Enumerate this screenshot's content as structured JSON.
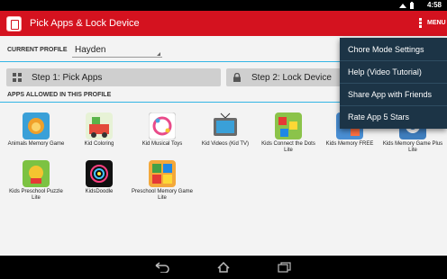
{
  "status": {
    "time": "4:58"
  },
  "appbar": {
    "title": "Pick Apps & Lock Device",
    "menu_label": "MENU"
  },
  "profile": {
    "label": "CURRENT PROFILE",
    "value": "Hayden"
  },
  "steps": {
    "step1": "Step 1: Pick Apps",
    "step2": "Step 2: Lock Device"
  },
  "section_title": "APPS ALLOWED IN THIS PROFILE",
  "apps": [
    {
      "name": "Animals Memory Game",
      "color": "#3aa0d8"
    },
    {
      "name": "Kid Coloring",
      "color": "#e7f2d6"
    },
    {
      "name": "Kid Musical Toys",
      "color": "#ffffff"
    },
    {
      "name": "Kid Videos (Kid TV)",
      "color": "#6a6a6a"
    },
    {
      "name": "Kids Connect the Dots Lite",
      "color": "#8bc34a"
    },
    {
      "name": "Kids Memory FREE",
      "color": "#4a8fd4"
    },
    {
      "name": "Kids Memory Game Plus Lite",
      "color": "#3f7fbf"
    },
    {
      "name": "Kids Preschool Puzzle Lite",
      "color": "#7cc242"
    },
    {
      "name": "KidsDoodle",
      "color": "#111111"
    },
    {
      "name": "Preschool Memory Game Lite",
      "color": "#f3a83b"
    }
  ],
  "menu": {
    "items": [
      "Chore Mode Settings",
      "Help (Video Tutorial)",
      "Share App with Friends",
      "Rate App 5 Stars"
    ]
  },
  "icons": {
    "step1": "grid-icon",
    "step2": "lock-icon",
    "overflow": "overflow-menu-icon",
    "nav_back": "back-icon",
    "nav_home": "home-icon",
    "nav_recent": "recents-icon"
  },
  "colors": {
    "appbar": "#d4121f",
    "accent": "#33b5e5",
    "menu_bg": "#1c3446"
  }
}
